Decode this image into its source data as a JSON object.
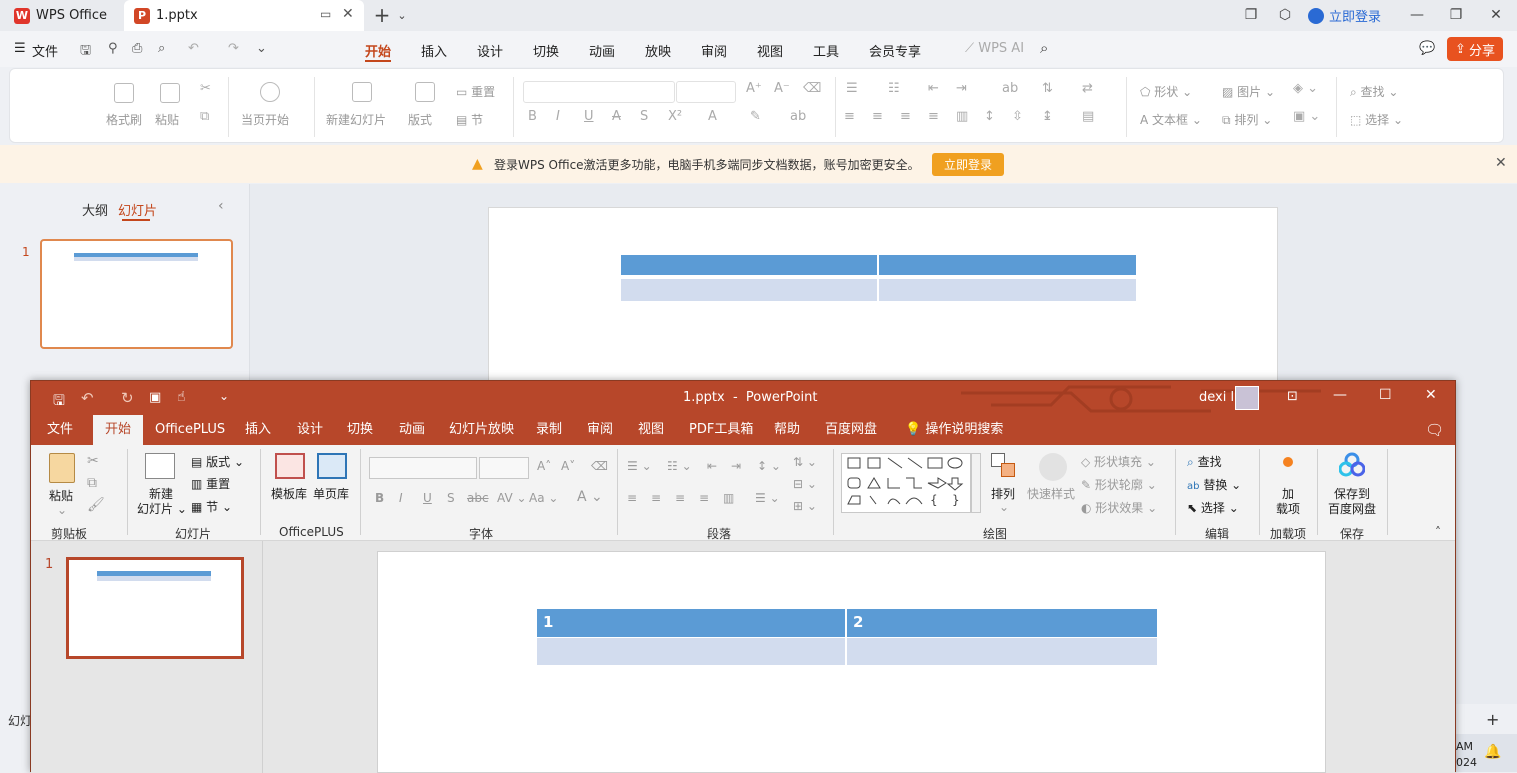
{
  "wps": {
    "home_tab": "WPS Office",
    "doc_tab": "1.pptx",
    "login": "立即登录",
    "menu": {
      "file": "文件",
      "tabs": [
        "开始",
        "插入",
        "设计",
        "切换",
        "动画",
        "放映",
        "审阅",
        "视图",
        "工具",
        "会员专享"
      ],
      "ai": "WPS AI",
      "share": "分享"
    },
    "ribbon": {
      "format_painter": "格式刷",
      "paste": "粘贴",
      "play_current": "当页开始",
      "new_slide": "新建幻灯片",
      "layout": "版式",
      "reset": "重置",
      "section": "节",
      "shape": "形状",
      "picture": "图片",
      "textbox": "文本框",
      "arrange": "排列",
      "find": "查找",
      "select": "选择"
    },
    "notice": {
      "text": "登录WPS Office激活更多功能，电脑手机多端同步文档数据，账号加密更安全。",
      "button": "立即登录"
    },
    "side": {
      "outline": "大纲",
      "slides": "幻灯片",
      "slide_number": "1"
    },
    "status_left": "幻灯",
    "tray_time": "AM",
    "tray_year": "024"
  },
  "pp": {
    "title": "1.pptx  -  PowerPoint",
    "user": "dexi lin",
    "tabs": [
      "文件",
      "开始",
      "OfficePLUS",
      "插入",
      "设计",
      "切换",
      "动画",
      "幻灯片放映",
      "录制",
      "审阅",
      "视图",
      "PDF工具箱",
      "帮助",
      "百度网盘"
    ],
    "tell_me": "操作说明搜索",
    "ribbon": {
      "paste": "粘贴",
      "clipboard": "剪贴板",
      "new_slide_1": "新建",
      "new_slide_2": "幻灯片",
      "layout": "版式",
      "reset": "重置",
      "section": "节",
      "slides_group": "幻灯片",
      "template": "模板库",
      "single_page": "单页库",
      "officeplus_group": "OfficePLUS",
      "font_group": "字体",
      "paragraph_group": "段落",
      "arrange": "排列",
      "quick_styles": "快速样式",
      "shape_fill": "形状填充",
      "shape_outline": "形状轮廓",
      "shape_effects": "形状效果",
      "drawing_group": "绘图",
      "find": "查找",
      "replace": "替换",
      "select": "选择",
      "editing_group": "编辑",
      "addins_1": "加",
      "addins_2": "载项",
      "addins_group": "加载项",
      "save_to_1": "保存到",
      "save_to_2": "百度网盘",
      "save_group": "保存"
    },
    "slide_number": "1",
    "table": {
      "headers": [
        "1",
        "2"
      ]
    }
  },
  "colors": {
    "pp_red": "#b7472a",
    "table_header": "#5b9bd5",
    "table_row": "#d2dcee",
    "wps_accent": "#c4471c",
    "login_button": "#f0a020"
  }
}
